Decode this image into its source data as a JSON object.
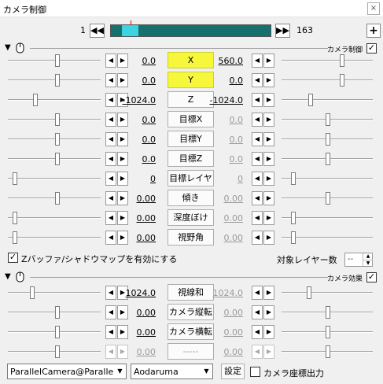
{
  "window": {
    "title": "カメラ制御",
    "close_glyph": "×"
  },
  "framebar": {
    "start": "1",
    "end": "163",
    "prev_glyph": "◀◀",
    "next_glyph": "▶▶",
    "add_glyph": "+",
    "selection_start_fraction": 0.07,
    "selection_end_fraction": 0.17,
    "timeline_color": "#15706e",
    "selection_color": "#3ed3e0",
    "cursor_color": "#e00000"
  },
  "group1": {
    "label": "カメラ制御",
    "checked": "✓"
  },
  "group2": {
    "label": "カメラ効果",
    "checked": "✓"
  },
  "stepper": {
    "left": "◀",
    "right": "▶"
  },
  "params1": [
    {
      "name": "X",
      "left": "0.0",
      "right": "560.0",
      "highlight": true
    },
    {
      "name": "Y",
      "left": "0.0",
      "right": "0.0",
      "highlight": true
    },
    {
      "name": "Z",
      "left": "-1024.0",
      "right": "-1024.0"
    },
    {
      "name": "目標X",
      "left": "0.0",
      "right": "0.0"
    },
    {
      "name": "目標Y",
      "left": "0.0",
      "right": "0.0"
    },
    {
      "name": "目標Z",
      "left": "0.0",
      "right": "0.0"
    },
    {
      "name": "目標レイヤ",
      "left": "0",
      "right": "0"
    },
    {
      "name": "傾き",
      "left": "0.00",
      "right": "0.00"
    },
    {
      "name": "深度ぼけ",
      "left": "0.00",
      "right": "0.00"
    },
    {
      "name": "視野角",
      "left": "0.00",
      "right": "0.00"
    }
  ],
  "zbuffer": {
    "label": "Zバッファ/シャドウマップを有効にする",
    "checked": "✓"
  },
  "target_layer": {
    "label": "対象レイヤー数",
    "value": "--",
    "up": "▲",
    "down": "▼"
  },
  "params2": [
    {
      "name": "視線和",
      "left": "1024.0",
      "right": "1024.0"
    },
    {
      "name": "カメラ縦転",
      "left": "0.00",
      "right": "0.00"
    },
    {
      "name": "カメラ横転",
      "left": "0.00",
      "right": "0.00"
    },
    {
      "name": "-----",
      "left": "0.00",
      "right": "0.00"
    }
  ],
  "bottom": {
    "object_select": "ParallelCamera@ParallelC",
    "effect_select": "Aodaruma",
    "dropdown_glyph": "▼",
    "settings_label": "設定",
    "campos_label": "カメラ座標出力",
    "campos_checked": ""
  },
  "highlight_color": "#f6f63a"
}
